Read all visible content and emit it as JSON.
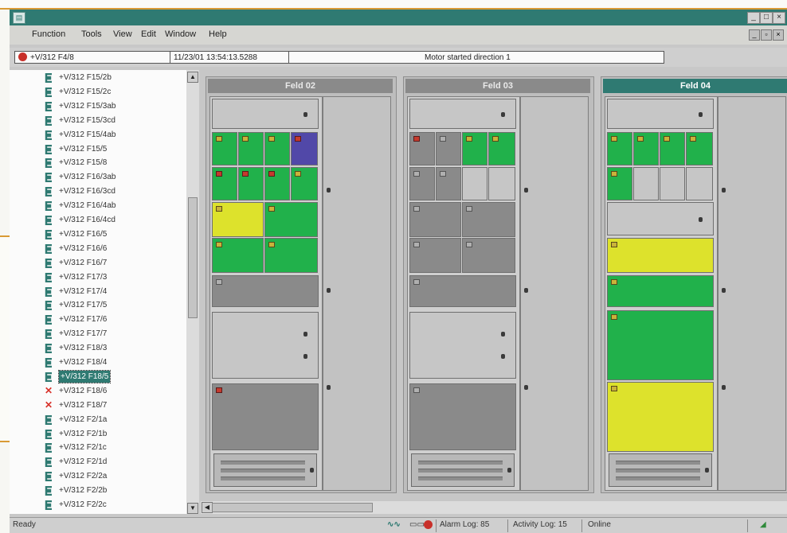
{
  "window": {
    "app_icon": "app-icon",
    "min_label": "_",
    "max_label": "□",
    "close_label": "×",
    "mdi_min_label": "_",
    "mdi_restore_label": "▫",
    "mdi_close_label": "×"
  },
  "menu": [
    "Function",
    "Tools",
    "View",
    "Edit",
    "Window",
    "Help"
  ],
  "infobar": {
    "item": "+V/312 F4/8",
    "timestamp": "11/23/01 13:54:13.5288",
    "message": "Motor started direction 1"
  },
  "tree": {
    "items": [
      {
        "label": "+V/312 F15/2b",
        "status": "ok"
      },
      {
        "label": "+V/312 F15/2c",
        "status": "ok"
      },
      {
        "label": "+V/312 F15/3ab",
        "status": "ok"
      },
      {
        "label": "+V/312 F15/3cd",
        "status": "ok"
      },
      {
        "label": "+V/312 F15/4ab",
        "status": "ok"
      },
      {
        "label": "+V/312 F15/5",
        "status": "ok"
      },
      {
        "label": "+V/312 F15/8",
        "status": "ok"
      },
      {
        "label": "+V/312 F16/3ab",
        "status": "ok"
      },
      {
        "label": "+V/312 F16/3cd",
        "status": "ok"
      },
      {
        "label": "+V/312 F16/4ab",
        "status": "ok"
      },
      {
        "label": "+V/312 F16/4cd",
        "status": "ok"
      },
      {
        "label": "+V/312 F16/5",
        "status": "ok"
      },
      {
        "label": "+V/312 F16/6",
        "status": "ok"
      },
      {
        "label": "+V/312 F16/7",
        "status": "ok"
      },
      {
        "label": "+V/312 F17/3",
        "status": "ok"
      },
      {
        "label": "+V/312 F17/4",
        "status": "ok"
      },
      {
        "label": "+V/312 F17/5",
        "status": "ok"
      },
      {
        "label": "+V/312 F17/6",
        "status": "ok"
      },
      {
        "label": "+V/312 F17/7",
        "status": "ok"
      },
      {
        "label": "+V/312 F18/3",
        "status": "ok"
      },
      {
        "label": "+V/312 F18/4",
        "status": "ok"
      },
      {
        "label": "+V/312 F18/5",
        "status": "selected"
      },
      {
        "label": "+V/312 F18/6",
        "status": "error"
      },
      {
        "label": "+V/312 F18/7",
        "status": "error"
      },
      {
        "label": "+V/312 F2/1a",
        "status": "ok"
      },
      {
        "label": "+V/312 F2/1b",
        "status": "ok"
      },
      {
        "label": "+V/312 F2/1c",
        "status": "ok"
      },
      {
        "label": "+V/312 F2/1d",
        "status": "ok"
      },
      {
        "label": "+V/312 F2/2a",
        "status": "ok"
      },
      {
        "label": "+V/312 F2/2b",
        "status": "ok"
      },
      {
        "label": "+V/312 F2/2c",
        "status": "ok"
      }
    ]
  },
  "colors": {
    "teal": "#2f7a72",
    "green": "#21b14b",
    "yellow": "#dde22c",
    "blue": "#5148a8",
    "dark_grey": "#8a8a8a",
    "light_grey": "#c6c6c6",
    "error_red": "#d8322a"
  },
  "cabinets": [
    {
      "title": "Feld 02",
      "active": false
    },
    {
      "title": "Feld 03",
      "active": false
    },
    {
      "title": "Feld 04",
      "active": true
    }
  ],
  "statusbar": {
    "ready": "Ready",
    "alarm_log": "Alarm Log: 85",
    "activity_log": "Activity Log: 15",
    "online": "Online"
  }
}
